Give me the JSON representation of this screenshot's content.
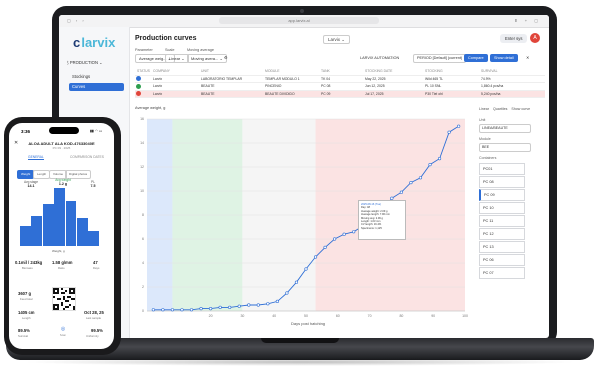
{
  "browser": {
    "url": "app.larvix.ai",
    "nav_icons": "▢ ‹ ›",
    "tools": "⬆ + ▢"
  },
  "sidebar": {
    "logo_brand": "larvix",
    "section_label": "PRODUCTION",
    "items": [
      {
        "label": "Stockings"
      },
      {
        "label": "Curves"
      }
    ]
  },
  "header": {
    "title": "Production curves",
    "farm_select": "Larvix",
    "enter_btn": "Enter sys",
    "avatar_letter": "A"
  },
  "filters": {
    "parameter_label": "Parameter",
    "scale_label": "Scale",
    "moving_avg_label": "Moving average",
    "parameter_value": "Average weig...",
    "scale_value": "Linear",
    "moving_avg_value": "Moving avera...",
    "larvix_automation": "LARVIX AUTOMATION",
    "period": "PERIOD [Default] (current)",
    "compare_btn": "Compare",
    "show_detail_btn": "Show detail"
  },
  "table": {
    "headers": [
      "STATUS",
      "COMPANY",
      "UNIT",
      "MODULE",
      "TANK",
      "STOCKING DATE",
      "STOCKING",
      "SURVIVAL"
    ],
    "rows": [
      {
        "status_color": "#2f6fd6",
        "cells": [
          "",
          "Larvix",
          "LABORATORIO TEMPLAR",
          "TEMPLAR MODULO 1",
          "TK 04",
          "May 22, 2025",
          "Wild 465 TL",
          "74.9%"
        ],
        "highlight": false
      },
      {
        "status_color": "#2e9e4f",
        "cells": [
          "",
          "Larvix",
          "BEAUTE",
          "PINCENIO",
          "PC 08",
          "Jun 12, 2025",
          "PL 10 SNL",
          "1,860.4 pcs/ha"
        ],
        "highlight": false
      },
      {
        "status_color": "#e0453a",
        "cells": [
          "",
          "Larvix",
          "BEAUTE",
          "BEAUTE DIVIDIDO",
          "PC 09",
          "Jul 17, 2025",
          "P30 Tiel ohl",
          "5,240 pcs/ha"
        ],
        "highlight": true
      }
    ]
  },
  "chart_data": {
    "type": "line",
    "title": "Average weight, g",
    "xlabel": "Days post hatching",
    "ylabel": "",
    "xlim": [
      0,
      100
    ],
    "ylim": [
      0,
      16
    ],
    "x_ticks": [
      20,
      30,
      40,
      50,
      60,
      70,
      80,
      90,
      100
    ],
    "y_ticks": [
      0,
      2,
      4,
      6,
      8,
      10,
      12,
      14,
      16
    ],
    "series": [
      {
        "color": "#2f6fd6",
        "x": [
          2,
          5,
          8,
          11,
          14,
          17,
          20,
          23,
          26,
          29,
          32,
          35,
          38,
          41,
          44,
          47,
          50,
          53,
          56,
          59,
          62,
          65,
          68,
          71,
          74,
          77,
          80,
          83,
          86,
          89,
          92,
          95,
          98
        ],
        "y": [
          0.1,
          0.1,
          0.1,
          0.1,
          0.1,
          0.2,
          0.2,
          0.3,
          0.3,
          0.4,
          0.5,
          0.5,
          0.6,
          0.8,
          1.5,
          2.4,
          3.5,
          4.5,
          5.3,
          6.0,
          6.4,
          6.6,
          7.1,
          7.8,
          8.4,
          9.4,
          9.9,
          10.7,
          11.1,
          12.2,
          12.7,
          14.9,
          15.4
        ]
      }
    ],
    "bands": [
      {
        "x0": 0,
        "x1": 8,
        "color": "#dce8fb"
      },
      {
        "x0": 8,
        "x1": 30,
        "color": "#dff3e4"
      },
      {
        "x0": 30,
        "x1": 53,
        "color": "#f5f5f5"
      },
      {
        "x0": 53,
        "x1": 100,
        "color": "#fbe3e3"
      }
    ],
    "tooltip": {
      "title": "2025-08-16 (Tue)",
      "lines": [
        "Day: 48",
        "Average weight: 2.09 g",
        "Average length: 7.96 mm",
        "Moving avg: 2.09 g",
        "Length: 1.03 mm",
        "CV length: 16.4%",
        "Specimens: 1,125"
      ]
    }
  },
  "right_panel": {
    "tabs": [
      "Linear",
      "Quartiles",
      "Show curve"
    ],
    "unit_label": "Unit",
    "unit_value": "LINEA/BEAUTE",
    "module_label": "Module",
    "module_value": "BEE",
    "containers_label": "Containers",
    "containers": [
      "PC01",
      "PC 08",
      "PC 09",
      "PC 10",
      "PC 11",
      "PC 12",
      "PC 13",
      "PC 06",
      "PC 07"
    ]
  },
  "phone": {
    "time": "3:36",
    "status": "▮▮ ◠ ▭",
    "title": "ALOA ADULT ALA KOD-47633040E",
    "subtitle": "PC 09  ·  2025",
    "tabs": [
      "GENERAL",
      "COMPARISON DATES"
    ],
    "chips": [
      "Weight",
      "Length",
      "Volume",
      "Digital photos"
    ],
    "stat_left_label": "Avg stage",
    "stat_left_value": "14.1",
    "stat_mid_label": "Avg weight",
    "stat_mid_value": "1.2 g",
    "stat_right_label": "PL",
    "stat_right_value": "7.5",
    "hist_values": [
      0.34,
      0.51,
      0.72,
      1.0,
      0.77,
      0.48,
      0.26
    ],
    "hist_xlabel": "Weight, g",
    "kv": [
      {
        "value": "0.1mil / 243kg",
        "label": "Biomass"
      },
      {
        "value": "1.58 g/mm",
        "label": "Ratio"
      },
      {
        "value": "47",
        "label": "Days"
      },
      {
        "value": "3607 g",
        "label": "Feed total"
      },
      {
        "value": "1405 cm",
        "label": "Length"
      },
      {
        "value": "Oct 28, 25",
        "label": "Last sample"
      },
      {
        "value": "89.5%",
        "label": "Survival"
      },
      {
        "value": "99.5%",
        "label": "Uniformity"
      }
    ],
    "footer_icon": "◎",
    "footer_label": "Scan"
  }
}
